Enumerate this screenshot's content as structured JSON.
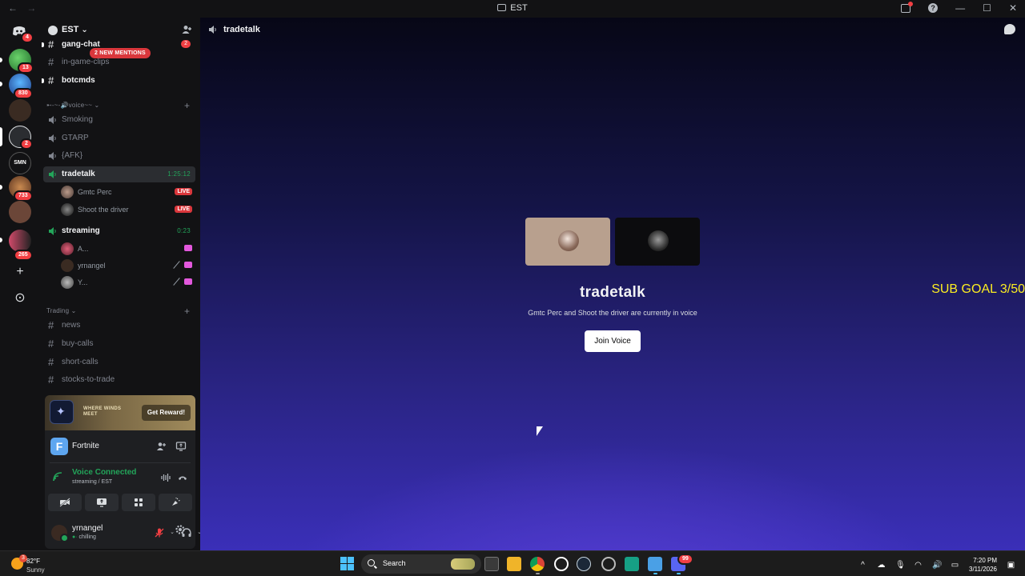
{
  "window": {
    "title": "EST",
    "back": "←",
    "forward": "→",
    "minimize": "—",
    "maximize": "☐",
    "close": "✕"
  },
  "rail": {
    "badges": [
      "4",
      "13",
      "830",
      "2",
      "733",
      "265"
    ],
    "add_label": "+",
    "discover_label": "⊙"
  },
  "server": {
    "name": "EST",
    "new_mentions": "2 NEW MENTIONS"
  },
  "channels": {
    "gang_chat": {
      "name": "gang-chat",
      "mention": "2"
    },
    "in_game_clips": "in-game-clips",
    "botcmds": "botcmds",
    "voice_category": "➸-~-🔊voice~~",
    "smoking": "Smoking",
    "gtarp": "GTARP",
    "afk": "{AFK}",
    "tradetalk": {
      "name": "tradetalk",
      "timer": "1:25:12"
    },
    "tradetalk_users": [
      {
        "name": "Gmtc Perc",
        "live": "LIVE"
      },
      {
        "name": "Shoot the driver",
        "live": "LIVE"
      }
    ],
    "streaming": {
      "name": "streaming",
      "timer": "0:23"
    },
    "streaming_users": [
      {
        "name": "A..."
      },
      {
        "name": "yrnangel"
      },
      {
        "name": "Y..."
      }
    ],
    "trading_category": "Trading",
    "news": "news",
    "buy_calls": "buy-calls",
    "short_calls": "short-calls",
    "stocks_to_trade": "stocks-to-trade"
  },
  "promo": {
    "logo_text": "WHERE WINDS MEET",
    "button": "Get Reward!"
  },
  "panel": {
    "game": "Fortnite",
    "voice_status": "Voice Connected",
    "voice_location": "streaming / EST",
    "username": "yrnangel",
    "user_status": "chilling"
  },
  "stage": {
    "channel": "tradetalk",
    "title": "tradetalk",
    "subtitle": "Gmtc Perc and Shoot the driver are currently in voice",
    "join_button": "Join Voice",
    "overlay": "SUB GOAL 3/50"
  },
  "taskbar": {
    "weather_badge": "3",
    "temperature": "82°F",
    "condition": "Sunny",
    "search_label": "Search",
    "discord_badge": "99",
    "time": "7:20 PM",
    "date": "3/11/2026"
  },
  "colors": {
    "live_red": "#da373c",
    "voice_green": "#23a55a",
    "sub_goal_yellow": "#fcee21",
    "join_button_bg": "#ffffff"
  }
}
